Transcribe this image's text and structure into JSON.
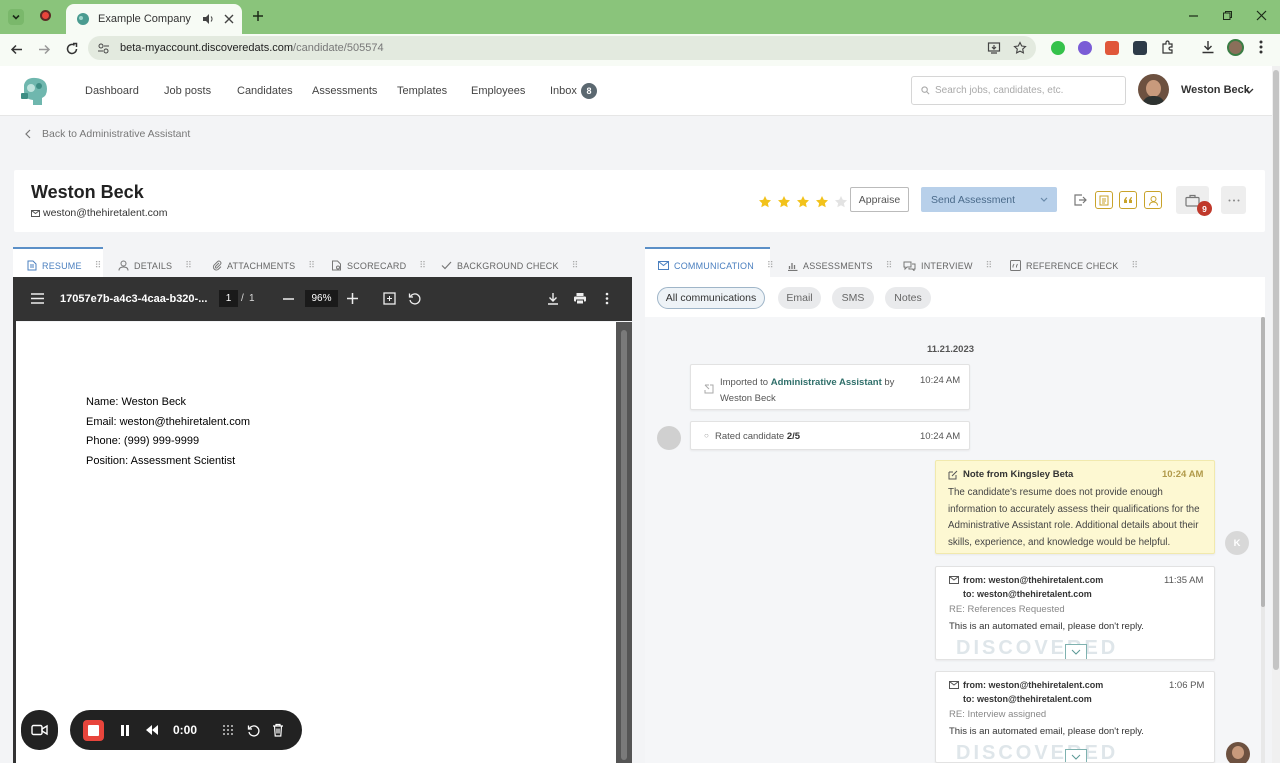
{
  "browser": {
    "tab_title": "Example Company",
    "url_domain": "beta-myaccount.discoveredats.com",
    "url_path": "/candidate/505574"
  },
  "nav": {
    "items": [
      "Dashboard",
      "Job posts",
      "Candidates",
      "Assessments",
      "Templates",
      "Employees",
      "Inbox"
    ],
    "inbox_count": "8",
    "search_placeholder": "Search jobs, candidates, etc.",
    "user_name": "Weston Beck"
  },
  "back_link": "Back to Administrative Assistant",
  "candidate": {
    "name": "Weston Beck",
    "email": "weston@thehiretalent.com",
    "rating": 4,
    "rating_max": 5,
    "appraise_label": "Appraise",
    "send_assessment_label": "Send Assessment",
    "jobs_badge": "9"
  },
  "left_tabs": [
    "RESUME",
    "DETAILS",
    "ATTACHMENTS",
    "SCORECARD",
    "BACKGROUND CHECK"
  ],
  "right_tabs": [
    "COMMUNICATION",
    "ASSESSMENTS",
    "INTERVIEW",
    "REFERENCE CHECK"
  ],
  "pdf": {
    "filename": "17057e7b-a4c3-4caa-b320-...",
    "page": "1",
    "page_sep": "/",
    "pages": "1",
    "zoom": "96%",
    "lines": [
      "Name: Weston Beck",
      "Email: weston@thehiretalent.com",
      "Phone: (999) 999-9999",
      "Position: Assessment Scientist"
    ]
  },
  "comm": {
    "filters": [
      "All communications",
      "Email",
      "SMS",
      "Notes"
    ],
    "date": "11.21.2023",
    "imported": {
      "prefix": "Imported to ",
      "job": "Administrative Assistant",
      "suffix": " by",
      "by": "Weston Beck",
      "time": "10:24 AM"
    },
    "rated": {
      "prefix": "Rated candidate ",
      "value": "2/5",
      "time": "10:24 AM"
    },
    "note": {
      "title": "Note from Kingsley Beta",
      "time": "10:24 AM",
      "body": "The candidate's resume does not provide enough information to accurately assess their qualifications for the Administrative Assistant role. Additional details about their skills, experience, and knowledge would be helpful.",
      "avatar_letter": "K"
    },
    "emails": [
      {
        "from": "from: weston@thehiretalent.com",
        "to": "to: weston@thehiretalent.com",
        "subject": "RE: References Requested",
        "body": "This is an automated email, please don't reply.",
        "time": "11:35 AM"
      },
      {
        "from": "from: weston@thehiretalent.com",
        "to": "to: weston@thehiretalent.com",
        "subject": "RE: Interview assigned",
        "body": "This is an automated email, please don't reply.",
        "time": "1:06 PM"
      }
    ],
    "watermark": "DISCOVERED"
  },
  "recorder": {
    "timer": "0:00"
  },
  "colors": {
    "brand": "#2f6f6a",
    "star": "#f2c21b",
    "chrome": "#8ac47b",
    "note_bg": "#fdf8d2",
    "badge": "#c0392b"
  }
}
